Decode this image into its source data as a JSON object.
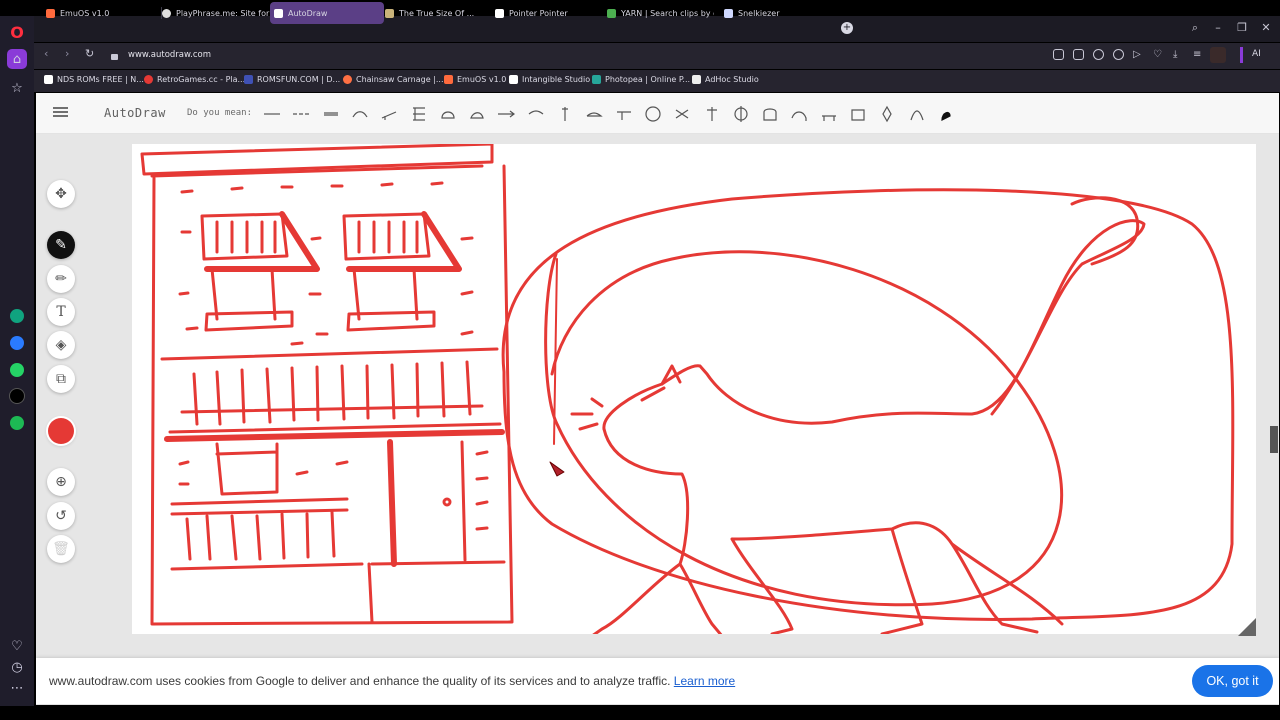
{
  "browser": {
    "tabs": [
      {
        "label": "EmuOS v1.0",
        "fav": "#ff6a3d"
      },
      {
        "label": "PlayPhrase.me: Site for cin",
        "fav": "#e0e0e0"
      },
      {
        "label": "AutoDraw",
        "fav": "#ffffff",
        "active": true
      },
      {
        "label": "The True Size Of ...",
        "fav": "#c9b37a"
      },
      {
        "label": "Pointer Pointer",
        "fav": "#ffffff"
      },
      {
        "label": "YARN | Search clips by qu",
        "fav": "#4caf50"
      },
      {
        "label": "Snelkiezer",
        "fav": "#cfd8ff"
      }
    ],
    "url": "www.autodraw.com",
    "ai_label": "AI",
    "bookmarks": [
      {
        "label": "NDS ROMs FREE | N...",
        "fav": "#ffffff"
      },
      {
        "label": "RetroGames.cc - Pla...",
        "fav": "#e53935"
      },
      {
        "label": "ROMSFUN.COM | D...",
        "fav": "#3f51b5"
      },
      {
        "label": "Chainsaw Carnage |...",
        "fav": "#ff7043"
      },
      {
        "label": "EmuOS v1.0",
        "fav": "#ff6a3d"
      },
      {
        "label": "Intangible Studio",
        "fav": "#ffffff"
      },
      {
        "label": "Photopea | Online P...",
        "fav": "#26a69a"
      },
      {
        "label": "AdHoc Studio",
        "fav": "#eeeeee"
      }
    ]
  },
  "app": {
    "title": "AutoDraw",
    "suggest_label": "Do you mean:",
    "suggestion_count": 24,
    "drawing_color": "#e53935"
  },
  "tools": [
    "move-icon",
    "autodraw-icon",
    "draw-icon",
    "type-icon",
    "fill-icon",
    "shape-icon",
    "zoom-icon",
    "undo-icon",
    "delete-icon"
  ],
  "cookie": {
    "text": "www.autodraw.com uses cookies from Google to deliver and enhance the quality of its services and to analyze traffic.",
    "learn_more": "Learn more",
    "ok": "OK, got it"
  }
}
